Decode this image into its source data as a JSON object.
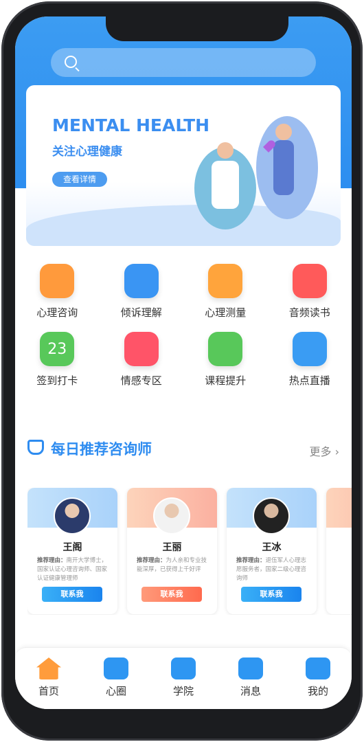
{
  "search": {
    "icon": "search-icon"
  },
  "banner": {
    "title": "MENTAL HEALTH",
    "subtitle": "关注心理健康",
    "button": "查看详情"
  },
  "features": [
    {
      "label": "心理咨询",
      "icon": "chat-heart-icon",
      "color": "#ff9a3c"
    },
    {
      "label": "倾诉理解",
      "icon": "phone-heart-icon",
      "color": "#3a95f3"
    },
    {
      "label": "心理测量",
      "icon": "clipboard-icon",
      "color": "#ffa43c"
    },
    {
      "label": "音频读书",
      "icon": "radio-icon",
      "color": "#ff5a5a"
    },
    {
      "label": "签到打卡",
      "icon": "calendar-icon",
      "color": "#58c85a",
      "text": "23"
    },
    {
      "label": "情感专区",
      "icon": "heart-icon",
      "color": "#ff5468"
    },
    {
      "label": "课程提升",
      "icon": "graduation-cap-icon",
      "color": "#58c85a"
    },
    {
      "label": "热点直播",
      "icon": "tv-play-icon",
      "color": "#3a9cf3"
    }
  ],
  "section": {
    "title": "每日推荐咨询师",
    "more": "更多"
  },
  "counselors": [
    {
      "name": "王阁",
      "reason_label": "推荐理由：",
      "reason": "南开大学博士，国家认证心理咨询师、国家认证健康管理师",
      "button": "联系我",
      "theme": "blue"
    },
    {
      "name": "王丽",
      "reason_label": "推荐理由：",
      "reason": "为人亲和专业技能深厚，已获得上千好评",
      "button": "联系我",
      "theme": "orange"
    },
    {
      "name": "王冰",
      "reason_label": "推荐理由：",
      "reason": "退伍军人心理志愿服务者，国家二级心理咨询师",
      "button": "联系我",
      "theme": "blue"
    }
  ],
  "tabs": [
    {
      "label": "首页",
      "icon": "home-icon",
      "active": true
    },
    {
      "label": "心圈",
      "icon": "heart-chat-icon"
    },
    {
      "label": "学院",
      "icon": "graduation-cap-icon"
    },
    {
      "label": "消息",
      "icon": "message-icon"
    },
    {
      "label": "我的",
      "icon": "user-icon"
    }
  ],
  "colors": {
    "primary": "#2e8cf0",
    "accent": "#ff9c3c"
  }
}
